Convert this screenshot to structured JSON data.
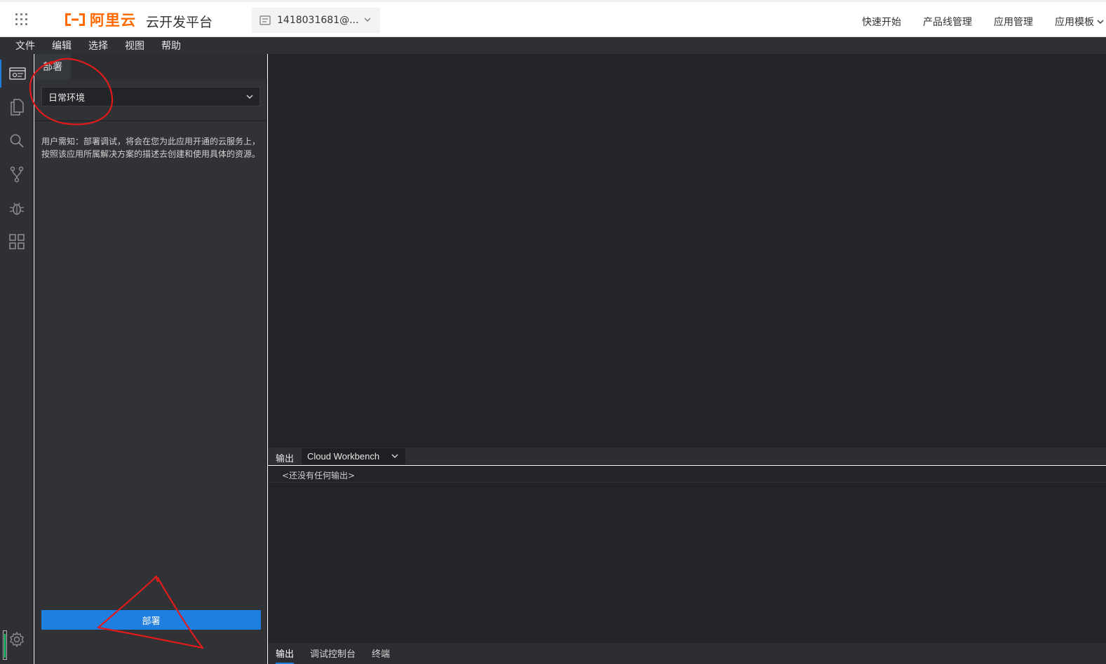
{
  "topbar": {
    "grid_icon": "apps-grid-icon",
    "logo_text": "阿里云",
    "brand_color": "#ff6a00",
    "platform_title": "云开发平台",
    "account_label": "1418031681@...",
    "nav": [
      "快速开始",
      "产品线管理",
      "应用管理",
      "应用模板"
    ]
  },
  "menubar": [
    "文件",
    "编辑",
    "选择",
    "视图",
    "帮助"
  ],
  "activity_icons": [
    "deploy-icon",
    "files-icon",
    "search-icon",
    "source-control-icon",
    "debug-icon",
    "extensions-icon",
    "gear-icon"
  ],
  "sidebar": {
    "tab_label": "部署",
    "env_selected": "日常环境",
    "notice": "用户需知：部署调试，将会在您为此应用开通的云服务上，按照该应用所属解决方案的描述去创建和使用具体的资源。",
    "deploy_button": "部署"
  },
  "panel": {
    "output_label": "输出",
    "channel": "Cloud Workbench",
    "empty_text": "<还没有任何输出>",
    "tabs": [
      "输出",
      "调试控制台",
      "终端"
    ]
  },
  "colors": {
    "accent": "#1e7fe0",
    "annotation": "#e01b1b",
    "status_ok": "#1bd170"
  }
}
